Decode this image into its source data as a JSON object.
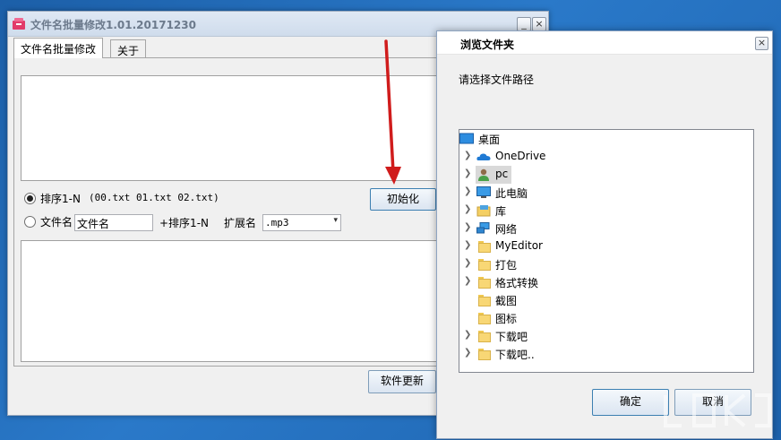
{
  "main": {
    "title": "文件名批量修改1.01.20171230",
    "tabs": [
      "文件名批量修改",
      "关于"
    ],
    "minimize": "_",
    "close": "×",
    "option_sort_label": "排序1-N",
    "option_sort_example": "(00.txt  01.txt 02.txt)",
    "option_name_label": "文件名",
    "name_input_value": "文件名",
    "plus_sort_label": "+排序1-N",
    "ext_label": "扩展名",
    "ext_value": ".mp3",
    "init_button": "初始化",
    "update_button": "软件更新"
  },
  "dialog": {
    "title": "浏览文件夹",
    "close": "×",
    "prompt": "请选择文件路径",
    "tree": [
      {
        "label": "桌面",
        "icon": "desktop-icon",
        "chevron": false
      },
      {
        "label": "OneDrive",
        "icon": "onedrive-cloud-icon",
        "chevron": true
      },
      {
        "label": "pc",
        "icon": "user-icon",
        "chevron": true,
        "selected": true
      },
      {
        "label": "此电脑",
        "icon": "computer-icon",
        "chevron": true
      },
      {
        "label": "库",
        "icon": "library-icon",
        "chevron": true
      },
      {
        "label": "网络",
        "icon": "network-icon",
        "chevron": true
      },
      {
        "label": "MyEditor",
        "icon": "folder-icon",
        "chevron": true
      },
      {
        "label": "打包",
        "icon": "folder-icon",
        "chevron": true
      },
      {
        "label": "格式转换",
        "icon": "folder-icon",
        "chevron": true
      },
      {
        "label": "截图",
        "icon": "folder-icon",
        "chevron": false
      },
      {
        "label": "图标",
        "icon": "folder-icon",
        "chevron": false
      },
      {
        "label": "下载吧",
        "icon": "folder-icon",
        "chevron": true
      },
      {
        "label": "下载吧..",
        "icon": "folder-icon",
        "chevron": true
      }
    ],
    "ok_button": "确定",
    "cancel_button": "取消"
  },
  "colors": {
    "accent_border": "#3c7fb1",
    "annotation_arrow": "#d01c1c",
    "folder": "#f8d775"
  }
}
